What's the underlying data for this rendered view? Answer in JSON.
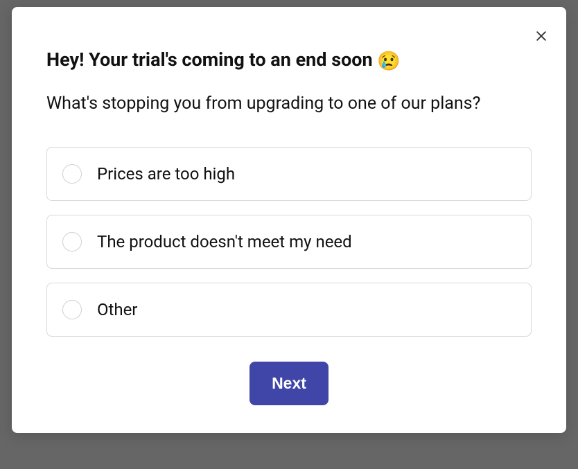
{
  "modal": {
    "title_text": "Hey! Your trial's coming to an end soon",
    "title_emoji": "😢",
    "question": "What's stopping you from upgrading to one of our plans?",
    "options": [
      {
        "label": "Prices are too high"
      },
      {
        "label": "The product doesn't meet my need"
      },
      {
        "label": "Other"
      }
    ],
    "next_label": "Next"
  }
}
